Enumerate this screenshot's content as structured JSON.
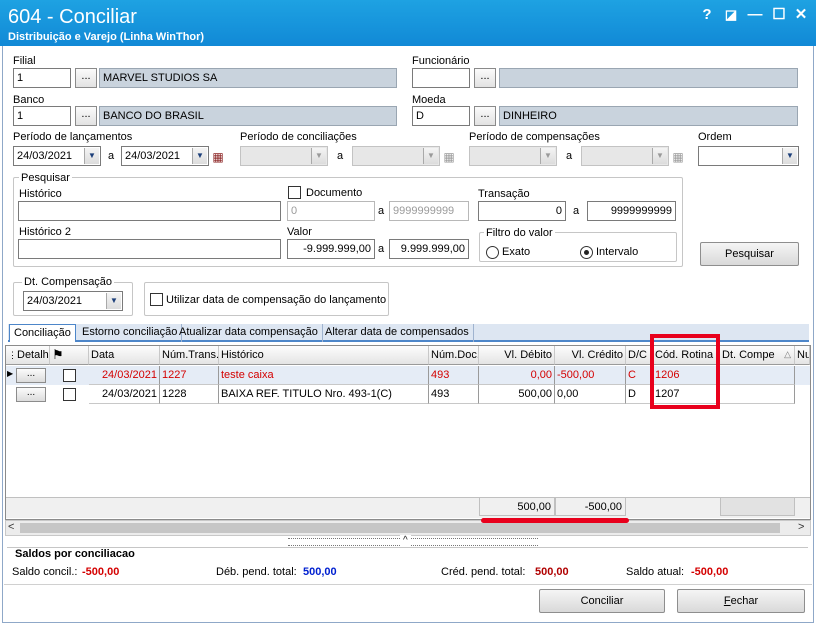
{
  "window": {
    "title": "604 - Conciliar",
    "subtitle": "Distribuição e Varejo (Linha WinThor)",
    "buttons": {
      "help": "?",
      "layout": "◪",
      "minimize": "—",
      "maximize": "☐",
      "close": "✕"
    }
  },
  "form": {
    "filial": {
      "label": "Filial",
      "code": "1",
      "name": "MARVEL STUDIOS SA"
    },
    "funcionario": {
      "label": "Funcionário",
      "code": "",
      "name": ""
    },
    "banco": {
      "label": "Banco",
      "code": "1",
      "name": "BANCO DO BRASIL"
    },
    "moeda": {
      "label": "Moeda",
      "code": "D",
      "name": "DINHEIRO"
    },
    "lookup_button": "...",
    "periodo_lancamentos": {
      "label": "Período de lançamentos",
      "from": "24/03/2021",
      "sep": "a",
      "to": "24/03/2021"
    },
    "periodo_conciliacoes": {
      "label": "Período de conciliações",
      "sep": "a"
    },
    "periodo_compensacoes": {
      "label": "Período de compensações",
      "sep": "a"
    },
    "ordem": {
      "label": "Ordem",
      "value": ""
    }
  },
  "pesquisar": {
    "group_label": "Pesquisar",
    "historico_label": "Histórico",
    "historico_value": "",
    "documento_label": "Documento",
    "documento_checked": false,
    "documento_from": "0",
    "documento_sep": "a",
    "documento_to": "9999999999",
    "transacao_label": "Transação",
    "transacao_from": "0",
    "transacao_sep": "a",
    "transacao_to": "9999999999",
    "historico2_label": "Histórico 2",
    "historico2_value": "",
    "valor_label": "Valor",
    "valor_from": "-9.999.999,00",
    "valor_sep": "a",
    "valor_to": "9.999.999,00",
    "filtro_label": "Filtro do valor",
    "filtro_options": [
      "Exato",
      "Intervalo"
    ],
    "filtro_selected": "Intervalo",
    "search_button": "Pesquisar"
  },
  "compensacao": {
    "label": "Dt. Compensação",
    "value": "24/03/2021",
    "use_launch_date_label": "Utilizar data de compensação do lançamento",
    "use_launch_date_checked": false
  },
  "tabs": [
    {
      "label": "Conciliação",
      "selected": true
    },
    {
      "label": "Estorno conciliação",
      "selected": false
    },
    {
      "label": "Atualizar data compensação",
      "selected": false
    },
    {
      "label": "Alterar data de compensados",
      "selected": false
    }
  ],
  "grid": {
    "columns": [
      "Detalh",
      "",
      "Data",
      "Núm.Trans.",
      "Histórico",
      "Núm.Doc.",
      "Vl. Débito",
      "Vl. Crédito",
      "D/C",
      "Cód. Rotina",
      "Dt. Compe",
      "Nu"
    ],
    "rows": [
      {
        "detail": "...",
        "checked": false,
        "data": "24/03/2021",
        "num_trans": "1227",
        "historico": "teste caixa",
        "num_doc": "493",
        "vl_debito": "0,00",
        "vl_credito": "-500,00",
        "dc": "C",
        "cod_rotina": "1206",
        "dt_compe": "",
        "highlight": "red"
      },
      {
        "detail": "...",
        "checked": false,
        "data": "24/03/2021",
        "num_trans": "1228",
        "historico": "BAIXA REF. TITULO Nro. 493-1(C)",
        "num_doc": "493",
        "vl_debito": "500,00",
        "vl_credito": "0,00",
        "dc": "D",
        "cod_rotina": "1207",
        "dt_compe": "",
        "highlight": "none"
      }
    ],
    "totals": {
      "vl_debito": "500,00",
      "vl_credito": "-500,00"
    }
  },
  "saldos": {
    "title": "Saldos por conciliacao",
    "saldo_concil_label": "Saldo concil.:",
    "saldo_concil_value": "-500,00",
    "deb_pend_label": "Déb. pend. total:",
    "deb_pend_value": "500,00",
    "cred_pend_label": "Créd. pend. total:",
    "cred_pend_value": "500,00",
    "saldo_atual_label": "Saldo atual:",
    "saldo_atual_value": "-500,00"
  },
  "actions": {
    "conciliar": "Conciliar",
    "fechar": "Fechar"
  },
  "colors": {
    "titlebar": "#1a96dc",
    "annotation": "#e8001c",
    "value_red": "#d40000",
    "value_blue": "#0020d0"
  }
}
